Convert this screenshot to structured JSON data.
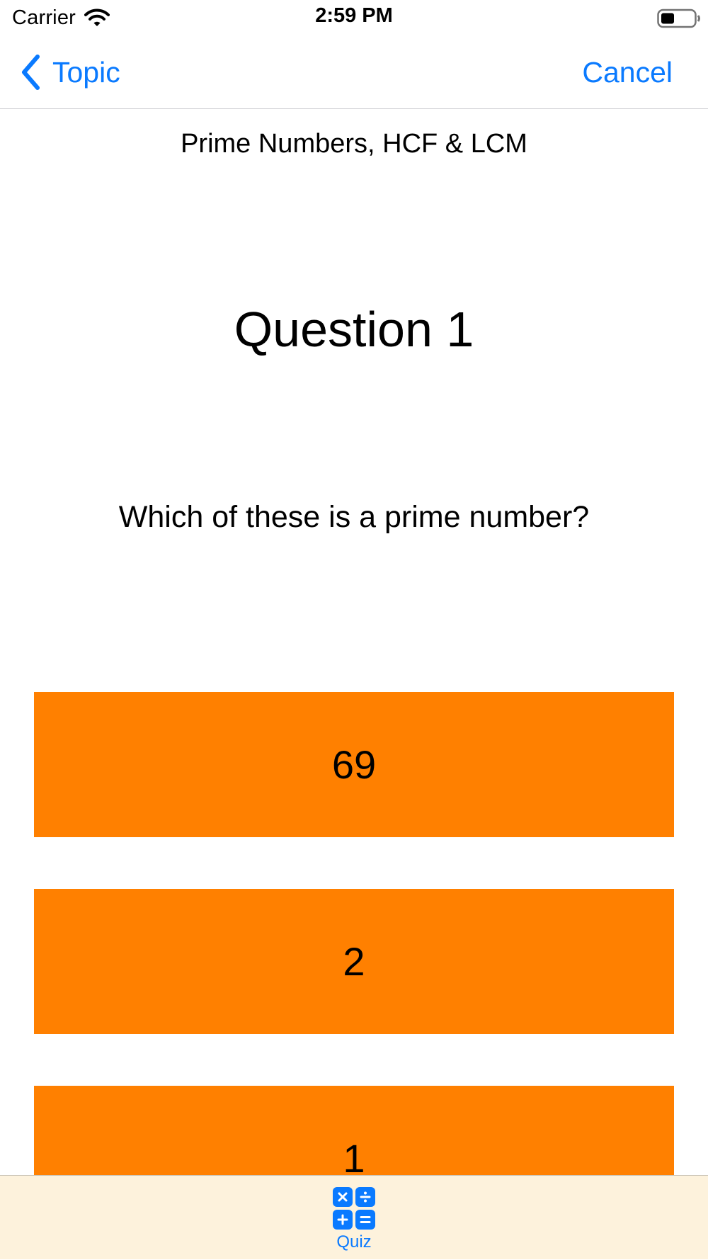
{
  "status_bar": {
    "carrier": "Carrier",
    "time": "2:59 PM",
    "wifi_icon": "wifi-icon",
    "battery_icon": "battery-icon"
  },
  "nav": {
    "back_label": "Topic",
    "back_icon": "chevron-left-icon",
    "cancel_label": "Cancel"
  },
  "quiz": {
    "topic": "Prime Numbers, HCF & LCM",
    "question_heading": "Question 1",
    "question_text": "Which of these is a prime number?",
    "answers": [
      "69",
      "2",
      "1"
    ]
  },
  "tab_bar": {
    "items": [
      {
        "label": "Quiz",
        "icon": "calculator-icon",
        "selected": true
      }
    ]
  },
  "colors": {
    "accent": "#0a7aff",
    "answer_background": "#ff8000",
    "tab_bar_background": "#fdf2dc"
  }
}
